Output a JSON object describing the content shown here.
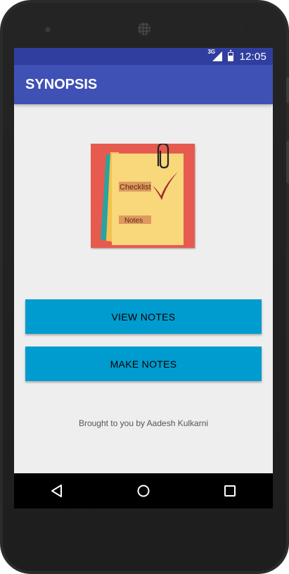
{
  "status_bar": {
    "network": "3G",
    "time": "12:05"
  },
  "app_bar": {
    "title": "SYNOPSIS"
  },
  "logo": {
    "checklist_label": "Checklist",
    "notes_label": "Notes"
  },
  "buttons": {
    "view_notes": "VIEW NOTES",
    "make_notes": "MAKE NOTES"
  },
  "footer": {
    "credit": "Brought to you by Aadesh Kulkarni"
  },
  "nav_bar": {
    "icons": [
      "back-icon",
      "home-icon",
      "recents-icon"
    ]
  },
  "colors": {
    "status_bar": "#303f9f",
    "app_bar": "#3f51b5",
    "button": "#009ccf",
    "background": "#eeeeee",
    "logo_red": "#e65a4f",
    "logo_yellow": "#f9d77b",
    "logo_teal": "#2aa3a0"
  }
}
